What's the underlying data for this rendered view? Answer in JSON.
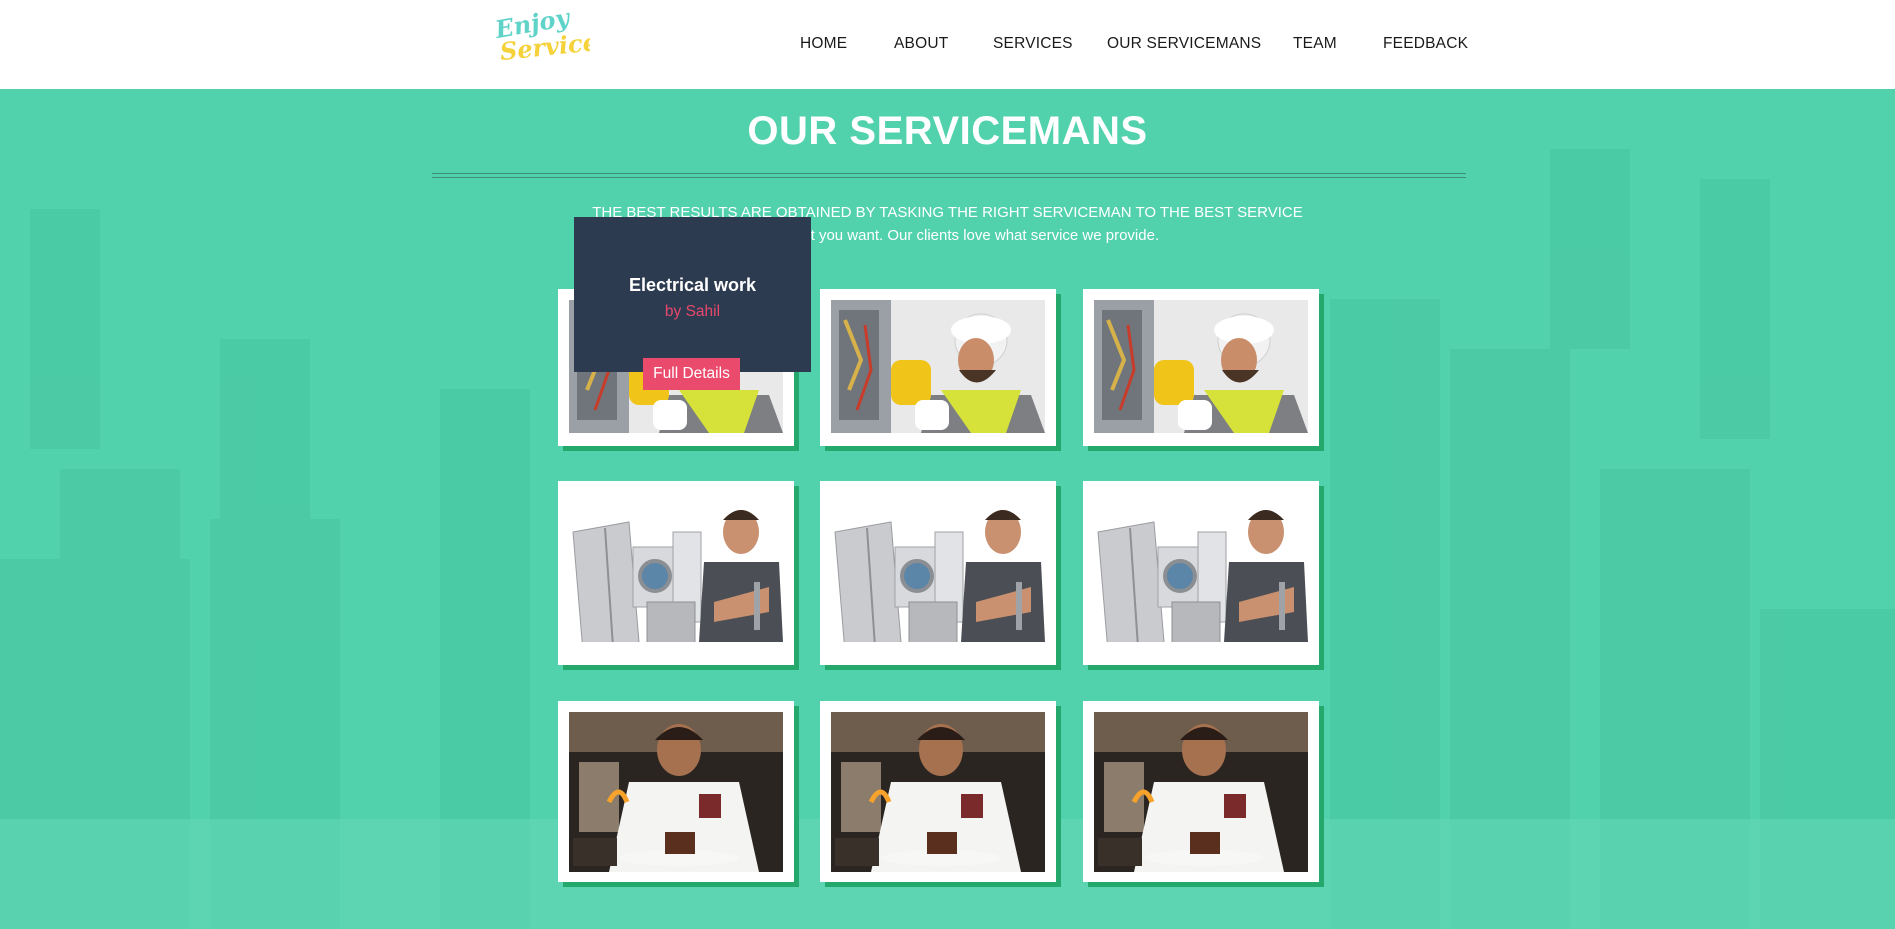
{
  "header": {
    "logo_text_line1": "Enjoy",
    "logo_text_line2": "Serviced",
    "nav": [
      "HOME",
      "ABOUT",
      "SERVICES",
      "OUR SERVICEMANS",
      "TEAM",
      "FEEDBACK"
    ]
  },
  "section": {
    "title": "OUR SERVICEMANS",
    "tagline_line1": "THE BEST RESULTS ARE OBTAINED BY TASKING THE RIGHT SERVICEMAN TO THE BEST SERVICE",
    "tagline_line2": "We do what you want. Our clients love what service we provide."
  },
  "hover_card": {
    "title": "Electrical work",
    "byline": "by Sahil",
    "button_label": "Full Details"
  },
  "cards": [
    {
      "image": "electrician-photo"
    },
    {
      "image": "electrician-photo"
    },
    {
      "image": "electrician-photo"
    },
    {
      "image": "appliance-repair-photo"
    },
    {
      "image": "appliance-repair-photo"
    },
    {
      "image": "appliance-repair-photo"
    },
    {
      "image": "chef-photo"
    },
    {
      "image": "chef-photo"
    },
    {
      "image": "chef-photo"
    }
  ],
  "colors": {
    "section_bg": "#52d1ad",
    "card_shadow": "#25a86c",
    "overlay_bg": "#2d3b51",
    "accent": "#ea4b6d"
  }
}
